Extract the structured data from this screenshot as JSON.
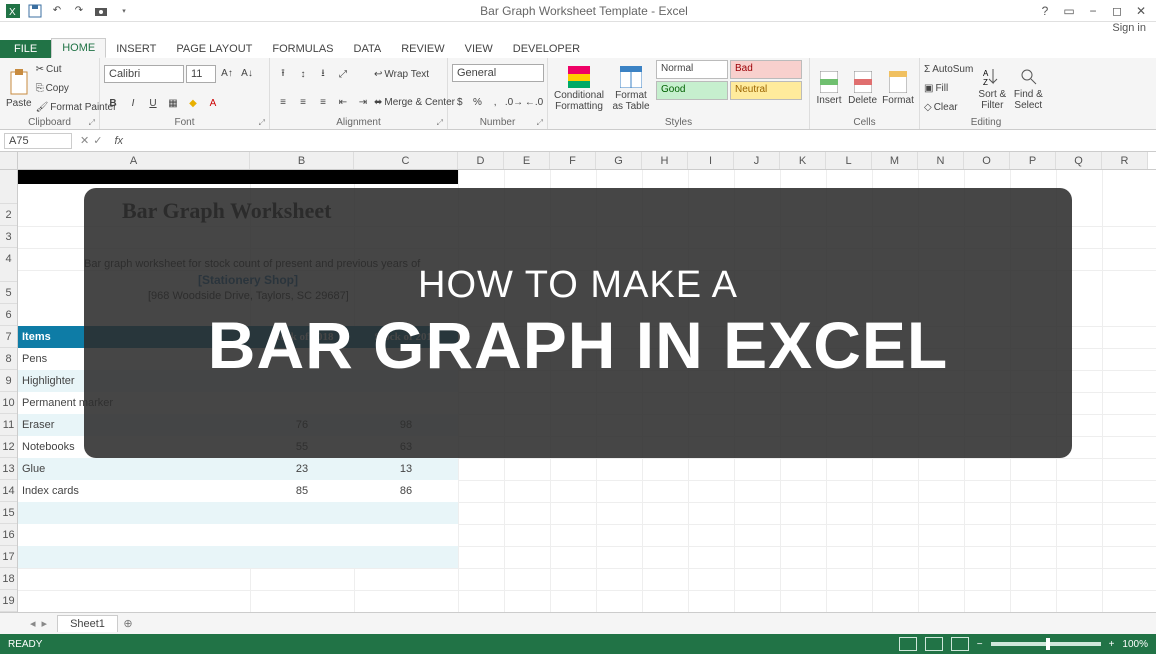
{
  "app": {
    "title": "Bar Graph Worksheet Template - Excel",
    "signin": "Sign in",
    "name_box": "A75",
    "status_ready": "READY",
    "zoom": "100%"
  },
  "tabs": {
    "file": "FILE",
    "home": "HOME",
    "insert": "INSERT",
    "page_layout": "PAGE LAYOUT",
    "formulas": "FORMULAS",
    "data": "DATA",
    "review": "REVIEW",
    "view": "VIEW",
    "developer": "DEVELOPER"
  },
  "ribbon": {
    "clipboard": {
      "label": "Clipboard",
      "paste": "Paste",
      "cut": "Cut",
      "copy": "Copy",
      "painter": "Format Painter"
    },
    "font": {
      "label": "Font",
      "name": "Calibri",
      "size": "11"
    },
    "alignment": {
      "label": "Alignment",
      "wrap": "Wrap Text",
      "merge": "Merge & Center"
    },
    "number": {
      "label": "Number",
      "format": "General"
    },
    "styles": {
      "label": "Styles",
      "conditional": "Conditional Formatting",
      "format_table": "Format as Table",
      "normal": "Normal",
      "bad": "Bad",
      "good": "Good",
      "neutral": "Neutral"
    },
    "cells": {
      "label": "Cells",
      "insert": "Insert",
      "delete": "Delete",
      "format": "Format"
    },
    "editing": {
      "label": "Editing",
      "autosum": "AutoSum",
      "fill": "Fill",
      "clear": "Clear",
      "sort": "Sort & Filter",
      "find": "Find & Select"
    }
  },
  "worksheet": {
    "title": "Bar Graph Worksheet",
    "subtitle": "Bar graph worksheet for stock count of present and previous years of",
    "shop": "[Stationery Shop]",
    "address": "[968 Woodside Drive, Taylors, SC 29687]",
    "columns": [
      "A",
      "B",
      "C",
      "D",
      "E",
      "F",
      "G",
      "H",
      "I",
      "J",
      "K",
      "L",
      "M",
      "N",
      "O",
      "P",
      "Q",
      "R"
    ],
    "table": {
      "headers": {
        "items": "Items",
        "s2018": "Stock of 2018",
        "s2019": "Stock of 2019"
      },
      "rows": [
        {
          "item": "Pens",
          "s2018": "",
          "s2019": ""
        },
        {
          "item": "Highlighter",
          "s2018": "",
          "s2019": ""
        },
        {
          "item": "Permanent marker",
          "s2018": "",
          "s2019": ""
        },
        {
          "item": "Eraser",
          "s2018": "76",
          "s2019": "98"
        },
        {
          "item": "Notebooks",
          "s2018": "55",
          "s2019": "63"
        },
        {
          "item": "Glue",
          "s2018": "23",
          "s2019": "13"
        },
        {
          "item": "Index cards",
          "s2018": "85",
          "s2019": "86"
        }
      ]
    },
    "sheet_tab": "Sheet1",
    "add_sheet": "⊕"
  },
  "overlay": {
    "line1": "HOW TO MAKE A",
    "line2": "BAR GRAPH IN EXCEL"
  }
}
